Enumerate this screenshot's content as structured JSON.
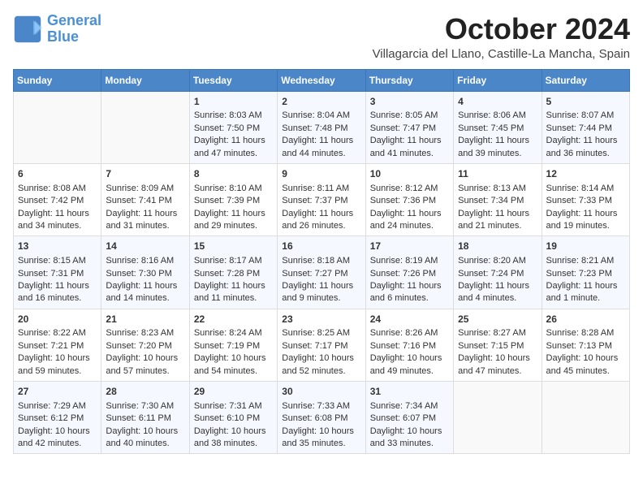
{
  "header": {
    "logo_line1": "General",
    "logo_line2": "Blue",
    "title": "October 2024",
    "subtitle": "Villagarcia del Llano, Castille-La Mancha, Spain"
  },
  "days_of_week": [
    "Sunday",
    "Monday",
    "Tuesday",
    "Wednesday",
    "Thursday",
    "Friday",
    "Saturday"
  ],
  "weeks": [
    [
      {
        "num": "",
        "lines": []
      },
      {
        "num": "",
        "lines": []
      },
      {
        "num": "1",
        "lines": [
          "Sunrise: 8:03 AM",
          "Sunset: 7:50 PM",
          "Daylight: 11 hours",
          "and 47 minutes."
        ]
      },
      {
        "num": "2",
        "lines": [
          "Sunrise: 8:04 AM",
          "Sunset: 7:48 PM",
          "Daylight: 11 hours",
          "and 44 minutes."
        ]
      },
      {
        "num": "3",
        "lines": [
          "Sunrise: 8:05 AM",
          "Sunset: 7:47 PM",
          "Daylight: 11 hours",
          "and 41 minutes."
        ]
      },
      {
        "num": "4",
        "lines": [
          "Sunrise: 8:06 AM",
          "Sunset: 7:45 PM",
          "Daylight: 11 hours",
          "and 39 minutes."
        ]
      },
      {
        "num": "5",
        "lines": [
          "Sunrise: 8:07 AM",
          "Sunset: 7:44 PM",
          "Daylight: 11 hours",
          "and 36 minutes."
        ]
      }
    ],
    [
      {
        "num": "6",
        "lines": [
          "Sunrise: 8:08 AM",
          "Sunset: 7:42 PM",
          "Daylight: 11 hours",
          "and 34 minutes."
        ]
      },
      {
        "num": "7",
        "lines": [
          "Sunrise: 8:09 AM",
          "Sunset: 7:41 PM",
          "Daylight: 11 hours",
          "and 31 minutes."
        ]
      },
      {
        "num": "8",
        "lines": [
          "Sunrise: 8:10 AM",
          "Sunset: 7:39 PM",
          "Daylight: 11 hours",
          "and 29 minutes."
        ]
      },
      {
        "num": "9",
        "lines": [
          "Sunrise: 8:11 AM",
          "Sunset: 7:37 PM",
          "Daylight: 11 hours",
          "and 26 minutes."
        ]
      },
      {
        "num": "10",
        "lines": [
          "Sunrise: 8:12 AM",
          "Sunset: 7:36 PM",
          "Daylight: 11 hours",
          "and 24 minutes."
        ]
      },
      {
        "num": "11",
        "lines": [
          "Sunrise: 8:13 AM",
          "Sunset: 7:34 PM",
          "Daylight: 11 hours",
          "and 21 minutes."
        ]
      },
      {
        "num": "12",
        "lines": [
          "Sunrise: 8:14 AM",
          "Sunset: 7:33 PM",
          "Daylight: 11 hours",
          "and 19 minutes."
        ]
      }
    ],
    [
      {
        "num": "13",
        "lines": [
          "Sunrise: 8:15 AM",
          "Sunset: 7:31 PM",
          "Daylight: 11 hours",
          "and 16 minutes."
        ]
      },
      {
        "num": "14",
        "lines": [
          "Sunrise: 8:16 AM",
          "Sunset: 7:30 PM",
          "Daylight: 11 hours",
          "and 14 minutes."
        ]
      },
      {
        "num": "15",
        "lines": [
          "Sunrise: 8:17 AM",
          "Sunset: 7:28 PM",
          "Daylight: 11 hours",
          "and 11 minutes."
        ]
      },
      {
        "num": "16",
        "lines": [
          "Sunrise: 8:18 AM",
          "Sunset: 7:27 PM",
          "Daylight: 11 hours",
          "and 9 minutes."
        ]
      },
      {
        "num": "17",
        "lines": [
          "Sunrise: 8:19 AM",
          "Sunset: 7:26 PM",
          "Daylight: 11 hours",
          "and 6 minutes."
        ]
      },
      {
        "num": "18",
        "lines": [
          "Sunrise: 8:20 AM",
          "Sunset: 7:24 PM",
          "Daylight: 11 hours",
          "and 4 minutes."
        ]
      },
      {
        "num": "19",
        "lines": [
          "Sunrise: 8:21 AM",
          "Sunset: 7:23 PM",
          "Daylight: 11 hours",
          "and 1 minute."
        ]
      }
    ],
    [
      {
        "num": "20",
        "lines": [
          "Sunrise: 8:22 AM",
          "Sunset: 7:21 PM",
          "Daylight: 10 hours",
          "and 59 minutes."
        ]
      },
      {
        "num": "21",
        "lines": [
          "Sunrise: 8:23 AM",
          "Sunset: 7:20 PM",
          "Daylight: 10 hours",
          "and 57 minutes."
        ]
      },
      {
        "num": "22",
        "lines": [
          "Sunrise: 8:24 AM",
          "Sunset: 7:19 PM",
          "Daylight: 10 hours",
          "and 54 minutes."
        ]
      },
      {
        "num": "23",
        "lines": [
          "Sunrise: 8:25 AM",
          "Sunset: 7:17 PM",
          "Daylight: 10 hours",
          "and 52 minutes."
        ]
      },
      {
        "num": "24",
        "lines": [
          "Sunrise: 8:26 AM",
          "Sunset: 7:16 PM",
          "Daylight: 10 hours",
          "and 49 minutes."
        ]
      },
      {
        "num": "25",
        "lines": [
          "Sunrise: 8:27 AM",
          "Sunset: 7:15 PM",
          "Daylight: 10 hours",
          "and 47 minutes."
        ]
      },
      {
        "num": "26",
        "lines": [
          "Sunrise: 8:28 AM",
          "Sunset: 7:13 PM",
          "Daylight: 10 hours",
          "and 45 minutes."
        ]
      }
    ],
    [
      {
        "num": "27",
        "lines": [
          "Sunrise: 7:29 AM",
          "Sunset: 6:12 PM",
          "Daylight: 10 hours",
          "and 42 minutes."
        ]
      },
      {
        "num": "28",
        "lines": [
          "Sunrise: 7:30 AM",
          "Sunset: 6:11 PM",
          "Daylight: 10 hours",
          "and 40 minutes."
        ]
      },
      {
        "num": "29",
        "lines": [
          "Sunrise: 7:31 AM",
          "Sunset: 6:10 PM",
          "Daylight: 10 hours",
          "and 38 minutes."
        ]
      },
      {
        "num": "30",
        "lines": [
          "Sunrise: 7:33 AM",
          "Sunset: 6:08 PM",
          "Daylight: 10 hours",
          "and 35 minutes."
        ]
      },
      {
        "num": "31",
        "lines": [
          "Sunrise: 7:34 AM",
          "Sunset: 6:07 PM",
          "Daylight: 10 hours",
          "and 33 minutes."
        ]
      },
      {
        "num": "",
        "lines": []
      },
      {
        "num": "",
        "lines": []
      }
    ]
  ]
}
